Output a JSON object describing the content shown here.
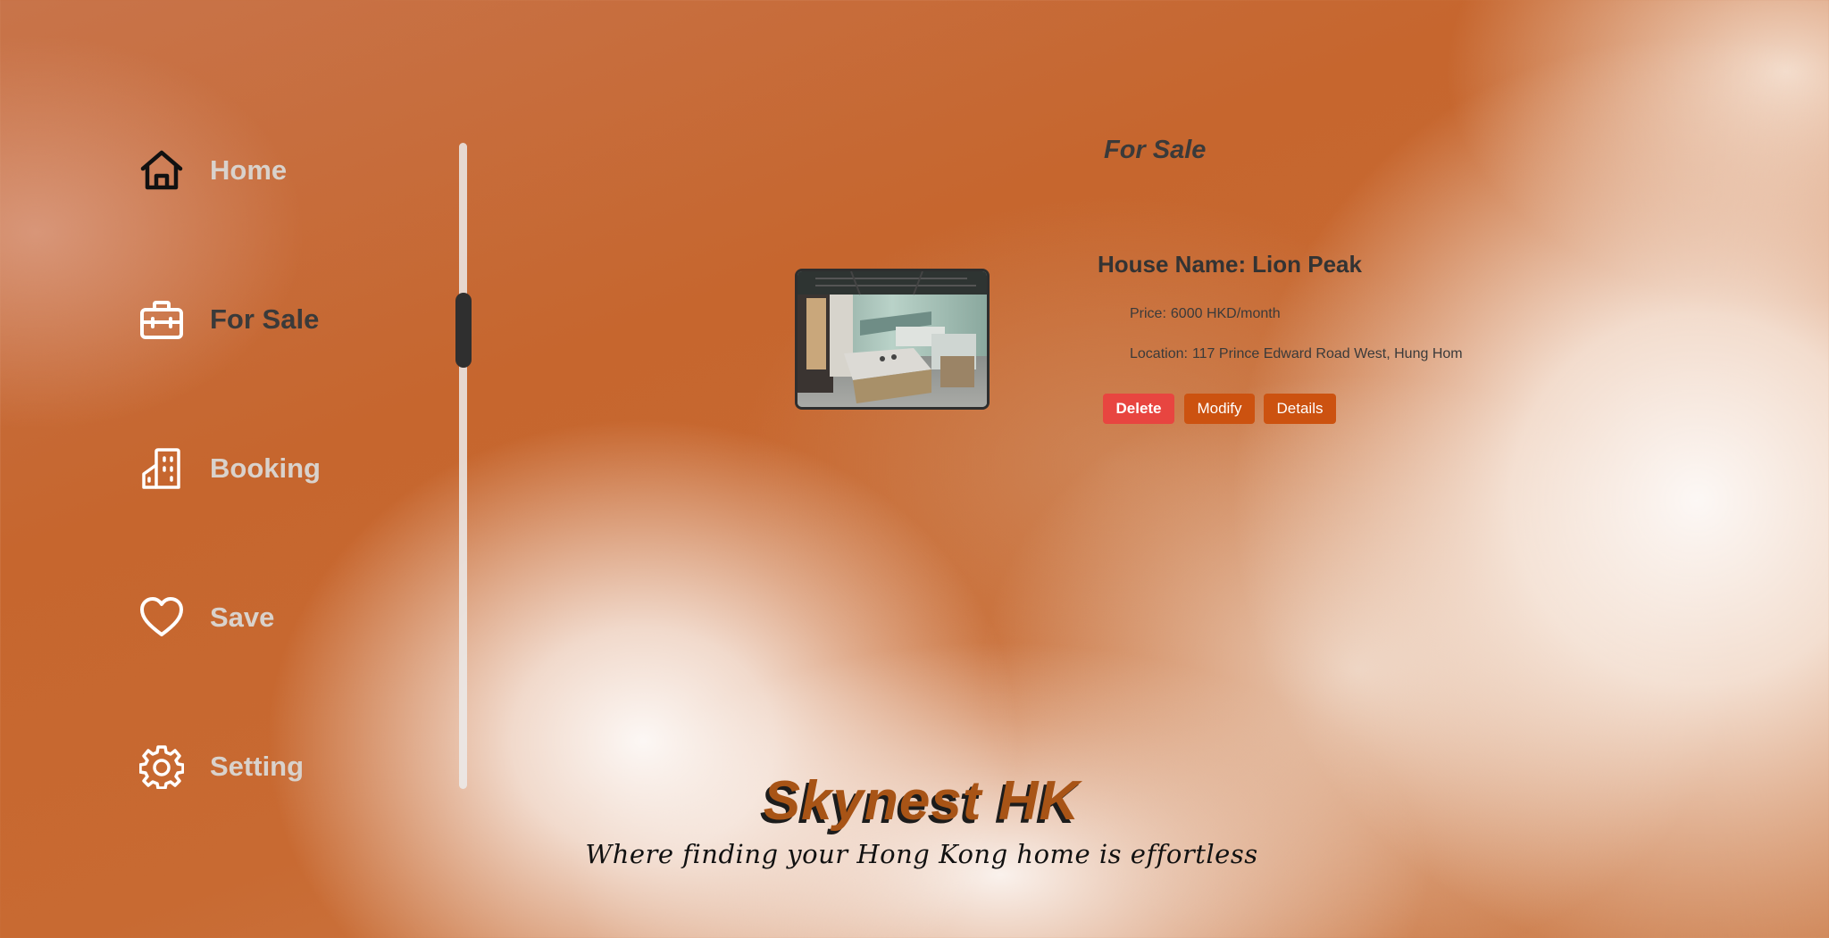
{
  "sidebar": {
    "items": [
      {
        "label": "Home",
        "icon": "house-icon"
      },
      {
        "label": "For Sale",
        "icon": "briefcase-icon",
        "active": true
      },
      {
        "label": "Booking",
        "icon": "building-icon"
      },
      {
        "label": "Save",
        "icon": "heart-icon"
      },
      {
        "label": "Setting",
        "icon": "gear-icon"
      }
    ]
  },
  "main": {
    "section_title": "For Sale",
    "listing": {
      "name_label": "House Name:",
      "name": "Lion Peak",
      "price_label": "Price:",
      "price": "6000 HKD/month",
      "location_label": "Location:",
      "location": "117 Prince Edward Road West, Hung Hom",
      "image_alt": "kitchen interior photo"
    },
    "actions": {
      "delete_label": "Delete",
      "modify_label": "Modify",
      "details_label": "Details"
    }
  },
  "brand": {
    "title": "Skynest HK",
    "tagline": "Where finding your Hong Kong home is effortless"
  },
  "colors": {
    "accent": "#cc5210",
    "danger": "#e84540",
    "active_text": "#3a3a3a",
    "inactive_text": "#d9d2cc"
  }
}
